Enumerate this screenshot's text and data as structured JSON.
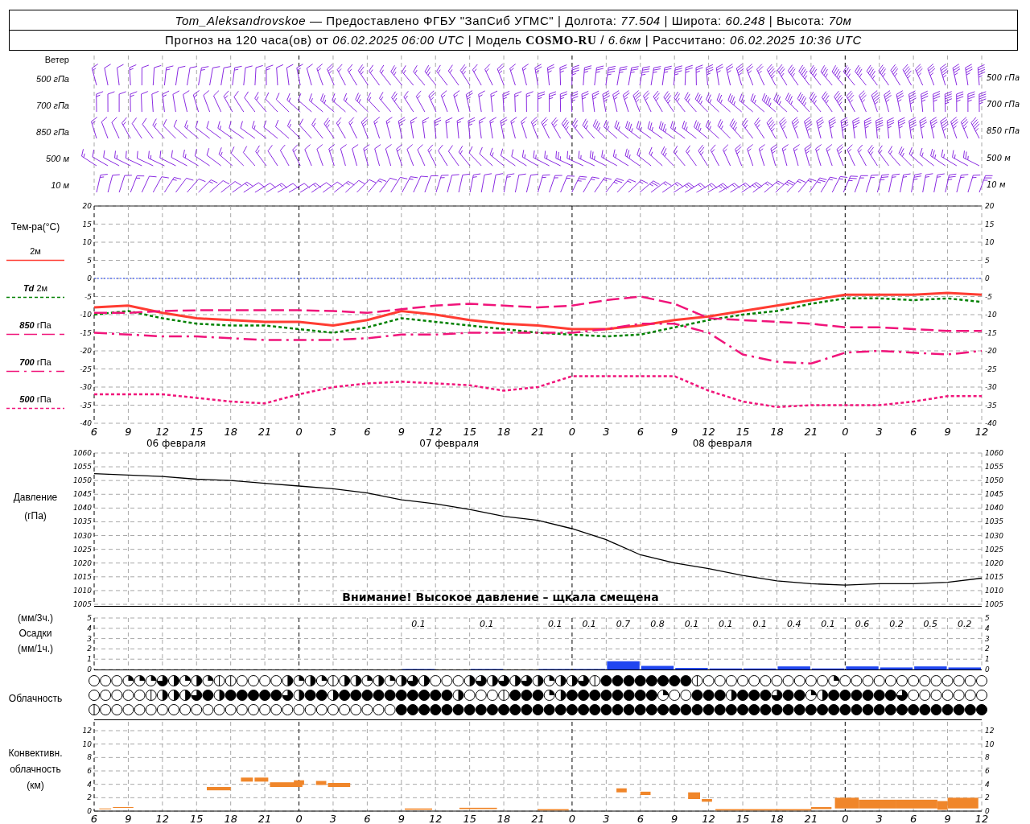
{
  "header": {
    "lines": [
      "*Tom_Aleksandrovskoe* — Предоставлено ФГБУ \"ЗапСиб УГМС\" | Долгота: *77.504* | Широта: *60.248* | Высота: *70м*",
      "Прогноз на 120 часа(ов) от *06.02.2025 06:00 UTC*  | Модель **COSMO-RU** / *6.6км* | Рассчитано: *06.02.2025 10:36 UTC*"
    ]
  },
  "wind": {
    "title": "Ветер",
    "levels": [
      {
        "label": "500 гПа",
        "right_label": "500 гПа"
      },
      {
        "label": "700 гПа",
        "right_label": "700 гПа"
      },
      {
        "label": "850 гПа",
        "right_label": "850 гПа"
      },
      {
        "label": "500 м",
        "right_label": "500 м"
      },
      {
        "label": "10  м",
        "right_label": "10  м"
      }
    ]
  },
  "temperature": {
    "title": "Тем-ра(°C)",
    "days": [
      "06 февраля",
      "07 февраля",
      "08 февраля"
    ],
    "right_axis": [
      "20",
      "15",
      "10",
      "5",
      "0",
      "-5",
      "-10",
      "-15",
      "-20",
      "-25",
      "-30",
      "-35",
      "-40"
    ],
    "chart_data": {
      "type": "line",
      "grid": true,
      "categories": [
        "6",
        "9",
        "12",
        "15",
        "18",
        "21",
        "0",
        "3",
        "6",
        "9",
        "12",
        "15",
        "18",
        "21",
        "0",
        "3",
        "6",
        "9",
        "12",
        "15",
        "18",
        "21",
        "0",
        "3",
        "6",
        "9",
        "12"
      ],
      "ylim": [
        -40,
        20
      ],
      "ref_lines": [
        {
          "axis": "y",
          "value": 0,
          "color": "#3050ff"
        }
      ],
      "yticks": [
        20,
        15,
        10,
        5,
        0,
        -5,
        -10,
        -15,
        -20,
        -25,
        -30,
        -35,
        -40
      ],
      "series": [
        {
          "name": "2м",
          "color": "#ff3c32",
          "line_style": "solid",
          "values": [
            -8,
            -7.5,
            -9.5,
            -11,
            -11.5,
            -12,
            -12,
            -13,
            -11.5,
            -9,
            -10,
            -11.5,
            -12.5,
            -13,
            -14,
            -14,
            -13,
            -11.5,
            -10.5,
            -9,
            -7.5,
            -6,
            -4.5,
            -4.5,
            -4.5,
            -4,
            -4.5
          ]
        },
        {
          "name": "*Td*  2м",
          "color": "#008000",
          "line_style": "dotted",
          "values": [
            -10,
            -9,
            -11,
            -12.5,
            -13,
            -13,
            -14,
            -15,
            -13.5,
            -11,
            -12,
            -13,
            -14,
            -15,
            -15.5,
            -16,
            -15.5,
            -13.5,
            -11.5,
            -10,
            -9,
            -7,
            -5.5,
            -5.5,
            -6,
            -5.5,
            -6.5
          ]
        },
        {
          "name": "*850* гПа",
          "color": "#f0147a",
          "line_style": "dashed",
          "values": [
            -9.5,
            -9.5,
            -9,
            -8.8,
            -8.8,
            -8.8,
            -8.8,
            -9,
            -9.5,
            -8.5,
            -7.5,
            -7,
            -7.5,
            -8,
            -7.5,
            -6,
            -5,
            -7,
            -11,
            -11.5,
            -12,
            -12.5,
            -13.5,
            -13.5,
            -14,
            -14.5,
            -14.5
          ]
        },
        {
          "name": "*700* гПа",
          "color": "#f0147a",
          "line_style": "dashdot",
          "values": [
            -15,
            -15.5,
            -16,
            -16,
            -16.5,
            -17,
            -17,
            -17,
            -16.5,
            -15.5,
            -15.5,
            -15,
            -15,
            -15,
            -15,
            -14,
            -12.5,
            -12.5,
            -15,
            -21,
            -23,
            -23.5,
            -20.5,
            -20,
            -20.5,
            -21,
            -20
          ]
        },
        {
          "name": "*500* гПа",
          "color": "#f0147a",
          "line_style": "dotted",
          "values": [
            -32,
            -32,
            -32,
            -33,
            -34,
            -34.5,
            -32,
            -30,
            -29,
            -28.5,
            -29,
            -29.5,
            -31,
            -30,
            -27,
            -27,
            -27,
            -27,
            -31,
            -34,
            -35.5,
            -35,
            -35,
            -35,
            -34,
            -32.5,
            -32.5
          ]
        }
      ]
    }
  },
  "pressure": {
    "labels": [
      "Давление",
      "(гПа)"
    ],
    "warning": "Внимание! Высокое давление – щкала смещена",
    "right_axis": [
      "1060",
      "1055",
      "1050",
      "1045",
      "1040",
      "1035",
      "1030",
      "1025",
      "1020",
      "1015",
      "1010",
      "1005"
    ],
    "chart_data": {
      "type": "line",
      "grid": true,
      "ylim": [
        1005,
        1060
      ],
      "yticks": [
        1060,
        1055,
        1050,
        1045,
        1040,
        1035,
        1030,
        1025,
        1020,
        1015,
        1010,
        1005
      ],
      "series": [
        {
          "color": "#000000",
          "values": [
            1052.5,
            1052,
            1051.5,
            1050.5,
            1050,
            1049,
            1048,
            1047,
            1045.5,
            1043,
            1041.5,
            1039.5,
            1037,
            1035.5,
            1032.5,
            1028.5,
            1023,
            1020,
            1018,
            1015.5,
            1013.5,
            1012.5,
            1012,
            1012.5,
            1012.5,
            1013,
            1014.5
          ]
        }
      ]
    }
  },
  "precipitation": {
    "labels": [
      "(мм/3ч.)",
      "Осадки",
      "(мм/1ч.)"
    ],
    "right_axis": [
      "5",
      "4",
      "3",
      "2",
      "1",
      "0"
    ],
    "chart_data": {
      "type": "bar",
      "grid": true,
      "ylim": [
        0,
        5
      ],
      "yticks": [
        5,
        4,
        3,
        2,
        1,
        0
      ],
      "series": [
        {
          "color": "#2046f0",
          "values": [
            0,
            0,
            0,
            0,
            0,
            0,
            0,
            0,
            0,
            0.05,
            0,
            0.05,
            0,
            0.05,
            0.05,
            0.8,
            0.35,
            0.15,
            0.1,
            0.1,
            0.3,
            0.1,
            0.3,
            0.2,
            0.3,
            0.2
          ]
        }
      ],
      "value_labels": [
        null,
        null,
        null,
        null,
        null,
        null,
        null,
        null,
        null,
        "0.1",
        null,
        "0.1",
        null,
        "0.1",
        "0.1",
        "0.7",
        "0.8",
        "0.1",
        "0.1",
        "0.1",
        "0.4",
        "0.1",
        "0.6",
        "0.2",
        "0.5",
        "0.2"
      ]
    }
  },
  "clouds": {
    "label": "Облачность",
    "rows": [
      {
        "cells": [
          {
            "kind": "clear"
          },
          {
            "kind": "clear"
          },
          {
            "kind": "clear"
          },
          {
            "kind": "quarter"
          },
          {
            "kind": "quarter"
          },
          {
            "kind": "quarter"
          },
          {
            "kind": "three"
          },
          {
            "kind": "half"
          },
          {
            "kind": "quarter"
          },
          {
            "kind": "half"
          },
          {
            "kind": "quarter"
          },
          {
            "kind": "line"
          },
          {
            "kind": "line"
          },
          {
            "kind": "clear"
          },
          {
            "kind": "clear"
          },
          {
            "kind": "clear"
          },
          {
            "kind": "clear"
          },
          {
            "kind": "half"
          },
          {
            "kind": "quarter"
          },
          {
            "kind": "half"
          },
          {
            "kind": "quarter"
          },
          {
            "kind": "line"
          },
          {
            "kind": "half"
          },
          {
            "kind": "half"
          },
          {
            "kind": "quarter"
          },
          {
            "kind": "half"
          },
          {
            "kind": "quarter"
          },
          {
            "kind": "half"
          },
          {
            "kind": "three"
          },
          {
            "kind": "half"
          },
          {
            "kind": "clear"
          },
          {
            "kind": "clear"
          },
          {
            "kind": "clear"
          },
          {
            "kind": "half"
          },
          {
            "kind": "three"
          },
          {
            "kind": "half"
          },
          {
            "kind": "three"
          },
          {
            "kind": "half"
          },
          {
            "kind": "three"
          },
          {
            "kind": "half"
          },
          {
            "kind": "quarter"
          },
          {
            "kind": "half"
          },
          {
            "kind": "half"
          },
          {
            "kind": "three"
          },
          {
            "kind": "line"
          },
          {
            "kind": "full"
          },
          {
            "kind": "full"
          },
          {
            "kind": "full"
          },
          {
            "kind": "full"
          },
          {
            "kind": "full"
          },
          {
            "kind": "full"
          },
          {
            "kind": "full"
          },
          {
            "kind": "full"
          },
          {
            "kind": "line"
          },
          {
            "kind": "clear"
          },
          {
            "kind": "clear"
          },
          {
            "kind": "clear"
          },
          {
            "kind": "clear"
          },
          {
            "kind": "clear"
          },
          {
            "kind": "clear"
          },
          {
            "kind": "clear"
          },
          {
            "kind": "clear"
          },
          {
            "kind": "clear"
          },
          {
            "kind": "clear"
          },
          {
            "kind": "clear"
          },
          {
            "kind": "quarter"
          },
          {
            "kind": "clear"
          },
          {
            "kind": "clear"
          },
          {
            "kind": "clear"
          },
          {
            "kind": "clear"
          },
          {
            "kind": "clear"
          },
          {
            "kind": "clear"
          },
          {
            "kind": "clear"
          },
          {
            "kind": "clear"
          },
          {
            "kind": "clear"
          },
          {
            "kind": "clear"
          },
          {
            "kind": "clear"
          },
          {
            "kind": "clear"
          },
          {
            "kind": "clear"
          }
        ]
      },
      {
        "cells": [
          {
            "kind": "clear"
          },
          {
            "kind": "clear"
          },
          {
            "kind": "clear"
          },
          {
            "kind": "clear"
          },
          {
            "kind": "clear"
          },
          {
            "kind": "line"
          },
          {
            "kind": "half"
          },
          {
            "kind": "half"
          },
          {
            "kind": "half"
          },
          {
            "kind": "three"
          },
          {
            "kind": "full"
          },
          {
            "kind": "half"
          },
          {
            "kind": "full"
          },
          {
            "kind": "full"
          },
          {
            "kind": "full"
          },
          {
            "kind": "full"
          },
          {
            "kind": "full"
          },
          {
            "kind": "three"
          },
          {
            "kind": "half"
          },
          {
            "kind": "full"
          },
          {
            "kind": "full"
          },
          {
            "kind": "half"
          },
          {
            "kind": "full"
          },
          {
            "kind": "full"
          },
          {
            "kind": "full"
          },
          {
            "kind": "full"
          },
          {
            "kind": "full"
          },
          {
            "kind": "full"
          },
          {
            "kind": "full"
          },
          {
            "kind": "full"
          },
          {
            "kind": "full"
          },
          {
            "kind": "full"
          },
          {
            "kind": "half"
          },
          {
            "kind": "clear"
          },
          {
            "kind": "clear"
          },
          {
            "kind": "clear"
          },
          {
            "kind": "line"
          },
          {
            "kind": "full"
          },
          {
            "kind": "full"
          },
          {
            "kind": "full"
          },
          {
            "kind": "quarter"
          },
          {
            "kind": "half"
          },
          {
            "kind": "full"
          },
          {
            "kind": "full"
          },
          {
            "kind": "full"
          },
          {
            "kind": "full"
          },
          {
            "kind": "full"
          },
          {
            "kind": "full"
          },
          {
            "kind": "full"
          },
          {
            "kind": "full"
          },
          {
            "kind": "quarter"
          },
          {
            "kind": "clear"
          },
          {
            "kind": "clear"
          },
          {
            "kind": "full"
          },
          {
            "kind": "full"
          },
          {
            "kind": "full"
          },
          {
            "kind": "half"
          },
          {
            "kind": "full"
          },
          {
            "kind": "full"
          },
          {
            "kind": "full"
          },
          {
            "kind": "three"
          },
          {
            "kind": "full"
          },
          {
            "kind": "full"
          },
          {
            "kind": "quarter"
          },
          {
            "kind": "half"
          },
          {
            "kind": "full"
          },
          {
            "kind": "full"
          },
          {
            "kind": "full"
          },
          {
            "kind": "full"
          },
          {
            "kind": "full"
          },
          {
            "kind": "full"
          },
          {
            "kind": "three"
          },
          {
            "kind": "clear"
          },
          {
            "kind": "clear"
          },
          {
            "kind": "clear"
          },
          {
            "kind": "clear"
          },
          {
            "kind": "clear"
          },
          {
            "kind": "clear"
          },
          {
            "kind": "clear"
          }
        ]
      },
      {
        "cells": [
          {
            "kind": "line"
          },
          {
            "kind": "clear"
          },
          {
            "kind": "clear"
          },
          {
            "kind": "clear"
          },
          {
            "kind": "clear"
          },
          {
            "kind": "clear"
          },
          {
            "kind": "clear"
          },
          {
            "kind": "clear"
          },
          {
            "kind": "clear"
          },
          {
            "kind": "clear"
          },
          {
            "kind": "clear"
          },
          {
            "kind": "clear"
          },
          {
            "kind": "clear"
          },
          {
            "kind": "clear"
          },
          {
            "kind": "clear"
          },
          {
            "kind": "clear"
          },
          {
            "kind": "clear"
          },
          {
            "kind": "clear"
          },
          {
            "kind": "clear"
          },
          {
            "kind": "clear"
          },
          {
            "kind": "clear"
          },
          {
            "kind": "clear"
          },
          {
            "kind": "clear"
          },
          {
            "kind": "clear"
          },
          {
            "kind": "clear"
          },
          {
            "kind": "clear"
          },
          {
            "kind": "clear"
          },
          {
            "kind": "full"
          },
          {
            "kind": "full"
          },
          {
            "kind": "full"
          },
          {
            "kind": "full"
          },
          {
            "kind": "full"
          },
          {
            "kind": "full"
          },
          {
            "kind": "full"
          },
          {
            "kind": "full"
          },
          {
            "kind": "full"
          },
          {
            "kind": "full"
          },
          {
            "kind": "full"
          },
          {
            "kind": "full"
          },
          {
            "kind": "full"
          },
          {
            "kind": "full"
          },
          {
            "kind": "full"
          },
          {
            "kind": "full"
          },
          {
            "kind": "full"
          },
          {
            "kind": "full"
          },
          {
            "kind": "full"
          },
          {
            "kind": "full"
          },
          {
            "kind": "full"
          },
          {
            "kind": "full"
          },
          {
            "kind": "full"
          },
          {
            "kind": "full"
          },
          {
            "kind": "full"
          },
          {
            "kind": "full"
          },
          {
            "kind": "full"
          },
          {
            "kind": "full"
          },
          {
            "kind": "full"
          },
          {
            "kind": "full"
          },
          {
            "kind": "full"
          },
          {
            "kind": "full"
          },
          {
            "kind": "full"
          },
          {
            "kind": "full"
          },
          {
            "kind": "full"
          },
          {
            "kind": "full"
          },
          {
            "kind": "full"
          },
          {
            "kind": "full"
          },
          {
            "kind": "full"
          },
          {
            "kind": "full"
          },
          {
            "kind": "full"
          },
          {
            "kind": "full"
          },
          {
            "kind": "full"
          },
          {
            "kind": "full"
          },
          {
            "kind": "full"
          },
          {
            "kind": "full"
          },
          {
            "kind": "full"
          },
          {
            "kind": "full"
          },
          {
            "kind": "full"
          },
          {
            "kind": "full"
          },
          {
            "kind": "full"
          },
          {
            "kind": "full"
          }
        ]
      }
    ]
  },
  "convective": {
    "labels": [
      "Конвективн.",
      "облачность",
      "(км)"
    ],
    "left_axis": [
      "12",
      "10",
      "8",
      "6",
      "4",
      "2",
      "0"
    ],
    "right_axis": [
      "12",
      "10",
      "8",
      "6",
      "4",
      "2",
      "0"
    ],
    "time_labels": [
      "6",
      "9",
      "12",
      "15",
      "18",
      "21",
      "0",
      "3",
      "6",
      "9",
      "12",
      "15",
      "18",
      "21",
      "0",
      "3",
      "6",
      "9",
      "12",
      "15",
      "18",
      "21",
      "0",
      "3",
      "6",
      "9",
      "12"
    ]
  }
}
